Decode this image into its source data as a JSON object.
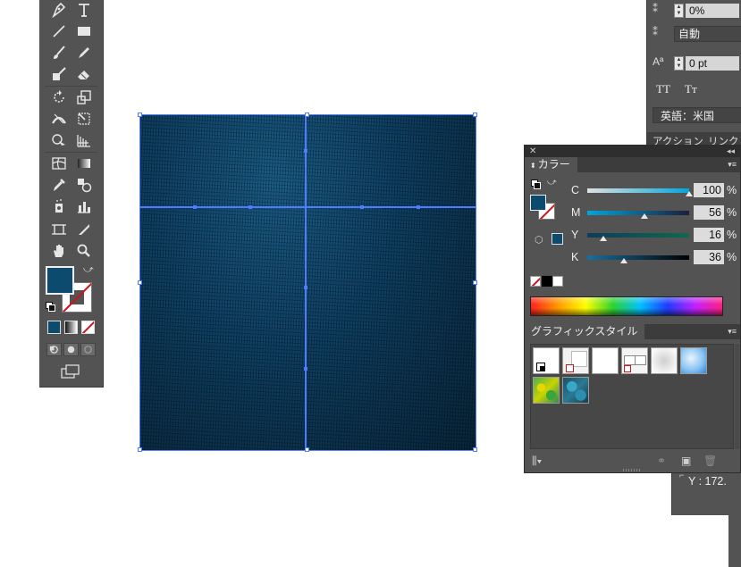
{
  "toolbar": {
    "tools": [
      "pen-tool",
      "type-tool",
      "line-tool",
      "rectangle-tool",
      "paintbrush-tool",
      "pencil-tool",
      "blob-brush-tool",
      "eraser-tool",
      "rotate-tool",
      "scale-tool",
      "width-tool",
      "free-transform-tool",
      "shape-builder-tool",
      "perspective-grid-tool",
      "mesh-tool",
      "gradient-tool",
      "eyedropper-tool",
      "blend-tool",
      "symbol-sprayer-tool",
      "column-graph-tool",
      "artboard-tool",
      "slice-tool",
      "hand-tool",
      "zoom-tool"
    ],
    "fill_color": "#0d4b6e"
  },
  "character_panel": {
    "tracking": "0%",
    "auto_leading": "自動",
    "baseline_shift": "0 pt",
    "all_caps": "TT",
    "small_caps": "Tт",
    "language": "英語：米国"
  },
  "tabs": {
    "actions": "アクション",
    "links": "リンク"
  },
  "color_panel": {
    "title": "カラー",
    "channels": [
      {
        "label": "C",
        "value": "100",
        "unit": "%",
        "fraction": 1.0,
        "from": "#e0e0e0",
        "to": "#00a6dc"
      },
      {
        "label": "M",
        "value": "56",
        "unit": "%",
        "fraction": 0.56,
        "from": "#00a6dc",
        "to": "#1d1f3a"
      },
      {
        "label": "Y",
        "value": "16",
        "unit": "%",
        "fraction": 0.16,
        "from": "#0f3c5c",
        "to": "#0d6a4c"
      },
      {
        "label": "K",
        "value": "36",
        "unit": "%",
        "fraction": 0.36,
        "from": "#1a6e9c",
        "to": "#000000"
      }
    ],
    "current_color": "#0d4b6e"
  },
  "graphic_styles_panel": {
    "title": "グラフィックスタイル"
  },
  "info_panel": {
    "y_readout": "Y : 172."
  },
  "artwork": {
    "fill": "#0d3f62"
  }
}
